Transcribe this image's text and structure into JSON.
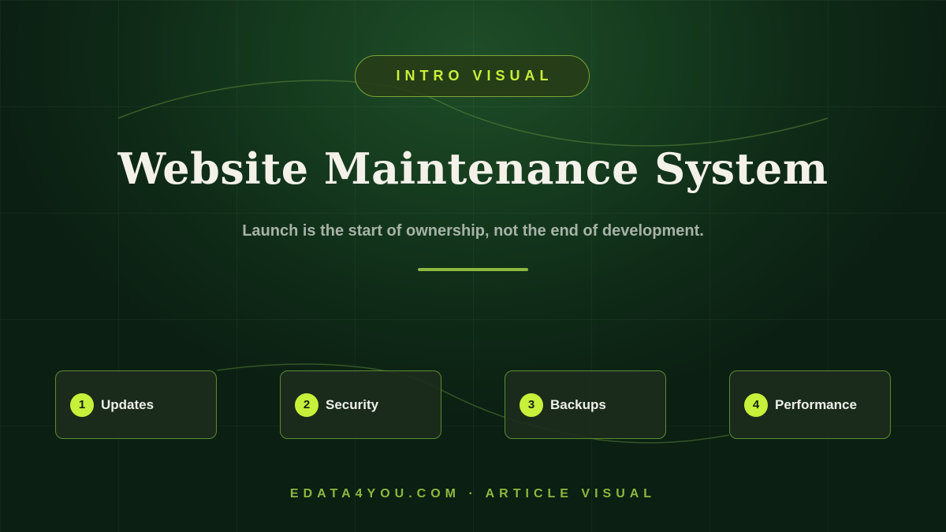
{
  "badge": {
    "label": "INTRO VISUAL"
  },
  "hero": {
    "title": "Website Maintenance System",
    "subtitle": "Launch is the start of ownership, not the end of development."
  },
  "steps": [
    {
      "number": "1",
      "label": "Updates"
    },
    {
      "number": "2",
      "label": "Security"
    },
    {
      "number": "3",
      "label": "Backups"
    },
    {
      "number": "4",
      "label": "Performance"
    }
  ],
  "footer": {
    "text": "EDATA4YOU.COM · ARTICLE VISUAL"
  },
  "colors": {
    "accent": "#c6f03a",
    "accent_muted": "#8db83f",
    "background": "#0f2a17",
    "title": "#f3f1e8",
    "subtitle": "#a7b3a6"
  }
}
